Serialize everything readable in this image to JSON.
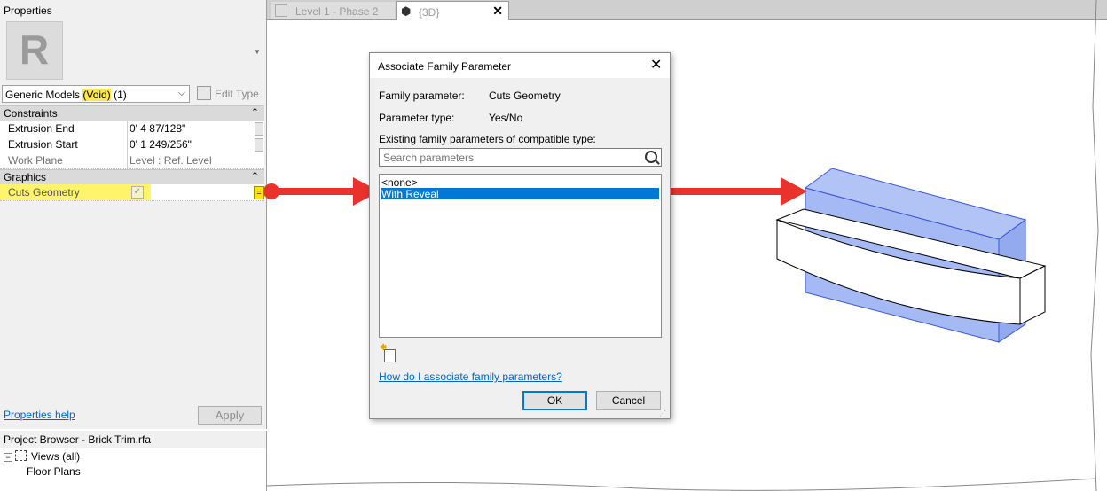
{
  "properties": {
    "title": "Properties",
    "type_selector": {
      "prefix": "Generic Models ",
      "highlight": "(Void)",
      "suffix": " (1)"
    },
    "edit_type": "Edit Type",
    "sections": [
      {
        "label": "Constraints",
        "rows": [
          {
            "key": "Extrusion End",
            "value": "0'  4 87/128\""
          },
          {
            "key": "Extrusion Start",
            "value": "0'  1 249/256\""
          },
          {
            "key": "Work Plane",
            "value": "Level : Ref. Level"
          }
        ]
      },
      {
        "label": "Graphics",
        "rows": [
          {
            "key": "Cuts Geometry",
            "value": "",
            "checked": true
          }
        ]
      }
    ],
    "help_link": "Properties help",
    "apply_label": "Apply",
    "logo_letter": "R"
  },
  "browser": {
    "title": "Project Browser - Brick Trim.rfa",
    "items": [
      "Views (all)",
      "Floor Plans"
    ]
  },
  "tabs": [
    {
      "label": "Level 1 - Phase 2"
    },
    {
      "label": "{3D}"
    }
  ],
  "dialog": {
    "title": "Associate Family Parameter",
    "family_parameter_label": "Family parameter:",
    "family_parameter_value": "Cuts Geometry",
    "parameter_type_label": "Parameter type:",
    "parameter_type_value": "Yes/No",
    "existing_label": "Existing family parameters of compatible type:",
    "search_placeholder": "Search parameters",
    "options": [
      "<none>",
      "With Reveal"
    ],
    "selected": "With Reveal",
    "help_link": "How do I associate family parameters?",
    "ok_label": "OK",
    "cancel_label": "Cancel"
  },
  "colors": {
    "arrow": "#e8322b",
    "void_fill": "#7f9df0",
    "highlight": "#fff46a",
    "selection": "#0078d7"
  }
}
